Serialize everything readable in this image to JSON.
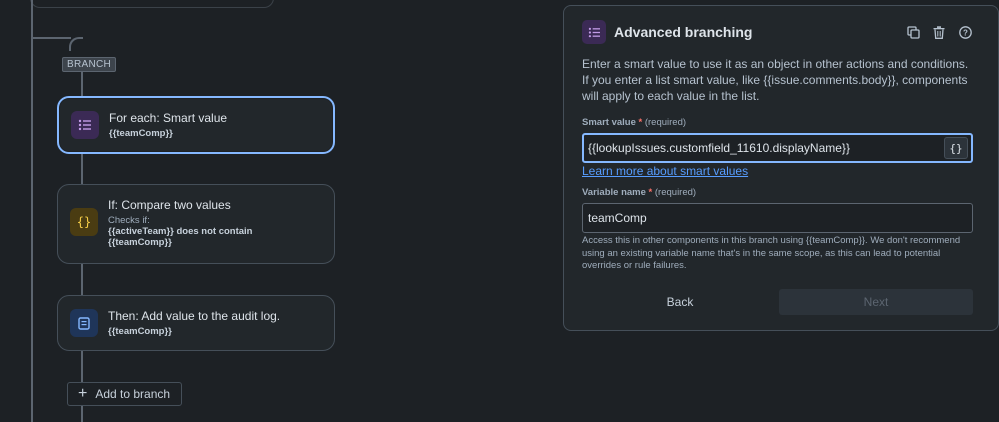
{
  "flow": {
    "branch_label": "BRANCH",
    "nodes": [
      {
        "title": "For each: Smart value",
        "detail": "{{teamComp}}",
        "icon": "list-icon",
        "selected": true
      },
      {
        "title": "If: Compare two values",
        "sub": "Checks if:",
        "detail_line1": "{{activeTeam}} does not contain",
        "detail_line2": "{{teamComp}}",
        "icon": "braces-icon"
      },
      {
        "title": "Then: Add value to the audit log.",
        "detail": "{{teamComp}}",
        "icon": "document-icon"
      }
    ],
    "add_button": "Add to branch"
  },
  "panel": {
    "title": "Advanced branching",
    "description": "Enter a smart value to use it as an object in other actions and conditions. If you enter a list smart value, like {{issue.comments.body}}, components will apply to each value in the list.",
    "smart_value": {
      "label": "Smart value",
      "required_text": "(required)",
      "value": "{{lookupIssues.customfield_11610.displayName}}",
      "button": "{}"
    },
    "learn_link": "Learn more about smart values",
    "variable_name": {
      "label": "Variable name",
      "required_text": "(required)",
      "value": "teamComp"
    },
    "help_text": "Access this in other components in this branch using {{teamComp}}. We don't recommend using an existing variable name that's in the same scope, as this can lead to potential overrides or rule failures.",
    "back_label": "Back",
    "next_label": "Next"
  },
  "colors": {
    "background": "#1d2125",
    "accent": "#85b8ff",
    "link": "#579dff",
    "required": "#f87168"
  }
}
